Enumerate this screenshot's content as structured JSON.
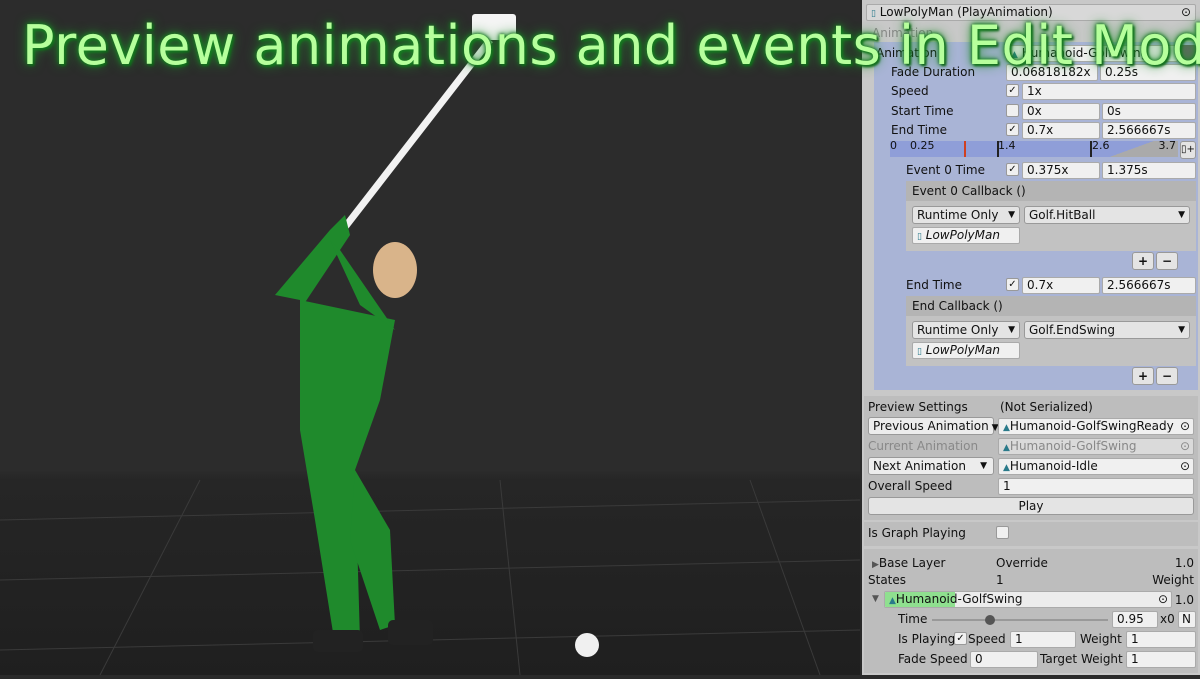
{
  "overlay_title": "Preview animations and events in Edit Mode",
  "inspector": {
    "header": "LowPolyMan (PlayAnimation)",
    "animation_section": "Animation",
    "animation_label": "Animation",
    "animation_value": "Humanoid-GolfSwing",
    "fade_duration": {
      "label": "Fade Duration",
      "normalized": "0.06818182x",
      "seconds": "0.25s"
    },
    "speed": {
      "label": "Speed",
      "checked": true,
      "value": "1x"
    },
    "start_time": {
      "label": "Start Time",
      "checked": false,
      "normalized": "0x",
      "seconds": "0s"
    },
    "end_time": {
      "label": "End Time",
      "checked": true,
      "normalized": "0.7x",
      "seconds": "2.566667s"
    },
    "timeline": {
      "ticks": [
        "0",
        "0.25",
        "1.4",
        "2.6",
        "3.7"
      ],
      "add_event_icon": "add-event-icon"
    },
    "event0_time": {
      "label": "Event 0 Time",
      "checked": true,
      "normalized": "0.375x",
      "seconds": "1.375s"
    },
    "event0_callback": {
      "header": "Event 0 Callback ()",
      "mode": "Runtime Only",
      "function": "Golf.HitBall",
      "target": "LowPolyMan"
    },
    "end_time2": {
      "label": "End Time",
      "checked": true,
      "normalized": "0.7x",
      "seconds": "2.566667s"
    },
    "end_callback": {
      "header": "End Callback ()",
      "mode": "Runtime Only",
      "function": "Golf.EndSwing",
      "target": "LowPolyMan"
    },
    "plus": "+",
    "minus": "−",
    "preview": {
      "label": "Preview Settings",
      "note": "(Not Serialized)",
      "previous_label": "Previous Animation",
      "previous_value": "Humanoid-GolfSwingReady",
      "current_label": "Current Animation",
      "current_value": "Humanoid-GolfSwing",
      "next_label": "Next Animation",
      "next_value": "Humanoid-Idle",
      "overall_speed_label": "Overall Speed",
      "overall_speed": "1",
      "play": "Play"
    },
    "graph": {
      "label": "Is Graph Playing",
      "checked": false
    },
    "layer": {
      "name": "Base Layer",
      "mode": "Override",
      "weight": "1.0",
      "states_label": "States",
      "states_count": "1",
      "weight_label": "Weight",
      "state_name": "Humanoid-GolfSwing",
      "state_weight": "1.0",
      "time_label": "Time",
      "time_value": "0.95",
      "time_progress": 0.95,
      "loops": "x0",
      "n_btn": "N",
      "is_playing_label": "Is Playing",
      "is_playing": true,
      "speed_label": "Speed",
      "speed": "1",
      "weight_field_label": "Weight",
      "weight_field": "1",
      "fade_speed_label": "Fade Speed",
      "fade_speed": "0",
      "target_weight_label": "Target Weight",
      "target_weight": "1"
    }
  }
}
